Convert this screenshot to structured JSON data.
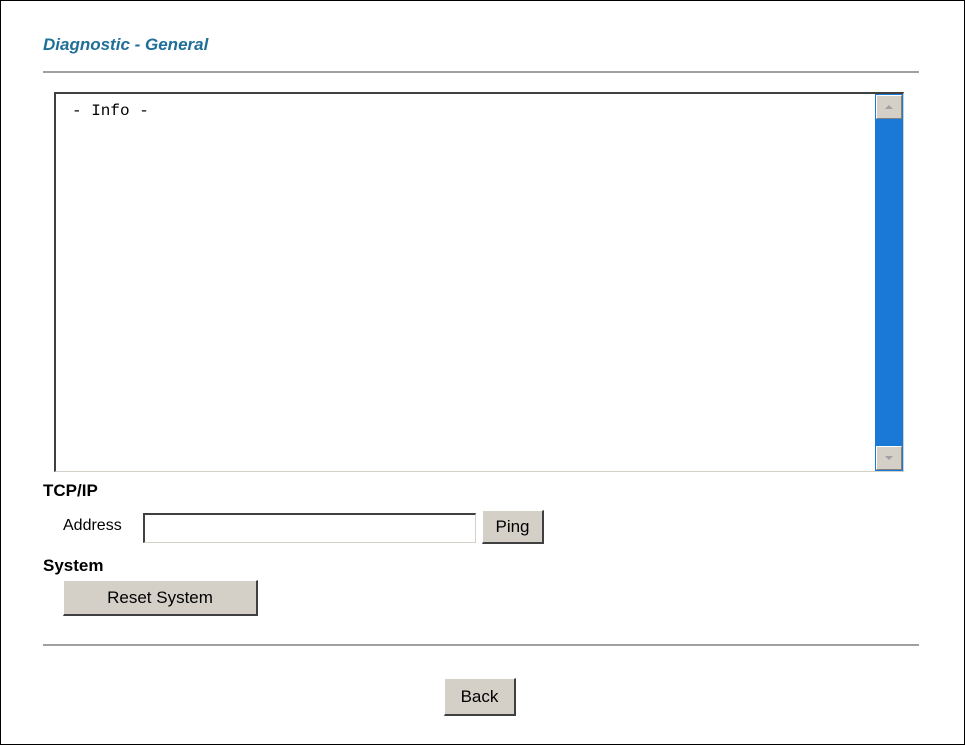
{
  "page": {
    "title": "Diagnostic - General"
  },
  "info": {
    "text": "- Info -"
  },
  "tcpip": {
    "heading": "TCP/IP",
    "address_label": "Address",
    "address_value": "",
    "ping_label": "Ping"
  },
  "system": {
    "heading": "System",
    "reset_label": "Reset System"
  },
  "footer": {
    "back_label": "Back"
  },
  "colors": {
    "title": "#1f6f98",
    "scrollbar_track": "#1a78d6",
    "button_face": "#d4d0c8"
  },
  "icons": {
    "scroll_up": "scroll-up-arrow-icon",
    "scroll_down": "scroll-down-arrow-icon"
  }
}
